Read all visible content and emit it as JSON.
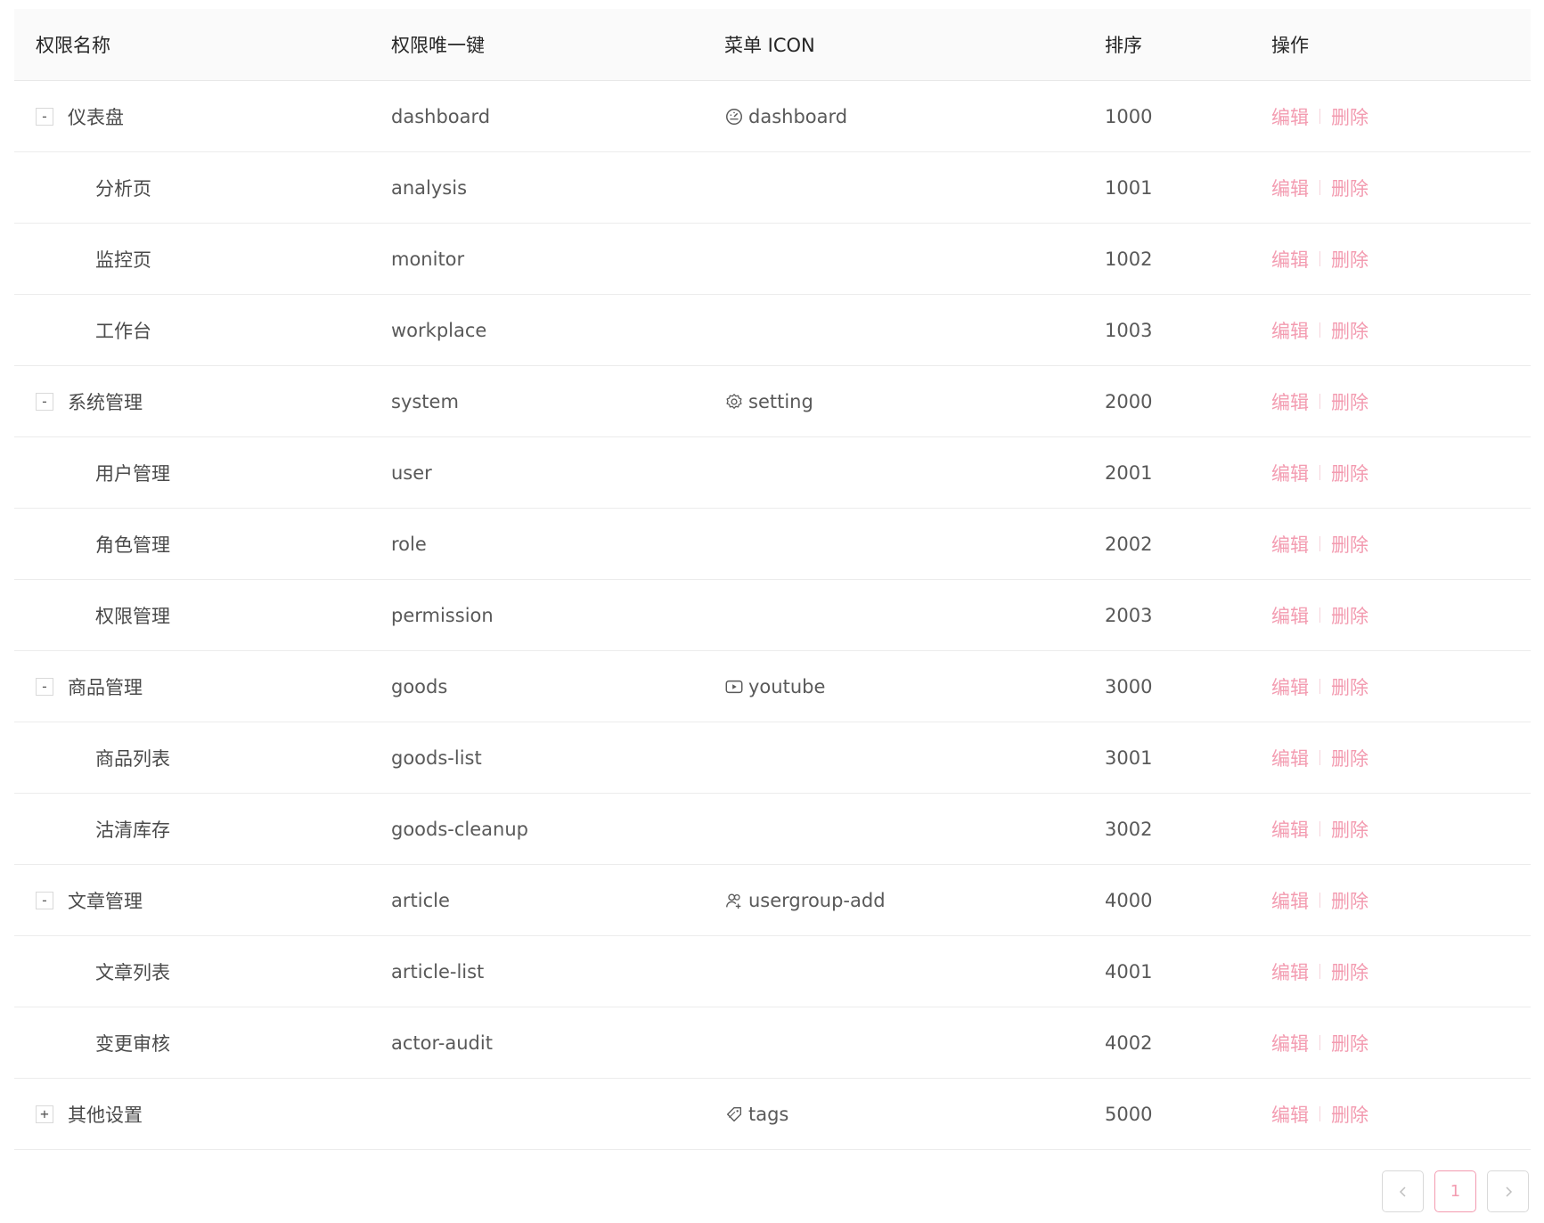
{
  "table": {
    "columns": {
      "name": "权限名称",
      "key": "权限唯一键",
      "icon": "菜单 ICON",
      "sort": "排序",
      "ops": "操作"
    },
    "rows": [
      {
        "name": "仪表盘",
        "key": "dashboard",
        "icon": "dashboard",
        "icon_name": "dashboard-icon",
        "sort": "1000",
        "level": 0,
        "toggle": "-"
      },
      {
        "name": "分析页",
        "key": "analysis",
        "icon": "",
        "sort": "1001",
        "level": 1
      },
      {
        "name": "监控页",
        "key": "monitor",
        "icon": "",
        "sort": "1002",
        "level": 1
      },
      {
        "name": "工作台",
        "key": "workplace",
        "icon": "",
        "sort": "1003",
        "level": 1
      },
      {
        "name": "系统管理",
        "key": "system",
        "icon": "setting",
        "icon_name": "setting-icon",
        "sort": "2000",
        "level": 0,
        "toggle": "-"
      },
      {
        "name": "用户管理",
        "key": "user",
        "icon": "",
        "sort": "2001",
        "level": 1
      },
      {
        "name": "角色管理",
        "key": "role",
        "icon": "",
        "sort": "2002",
        "level": 1
      },
      {
        "name": "权限管理",
        "key": "permission",
        "icon": "",
        "sort": "2003",
        "level": 1
      },
      {
        "name": "商品管理",
        "key": "goods",
        "icon": "youtube",
        "icon_name": "youtube-icon",
        "sort": "3000",
        "level": 0,
        "toggle": "-"
      },
      {
        "name": "商品列表",
        "key": "goods-list",
        "icon": "",
        "sort": "3001",
        "level": 1
      },
      {
        "name": "沽清库存",
        "key": "goods-cleanup",
        "icon": "",
        "sort": "3002",
        "level": 1
      },
      {
        "name": "文章管理",
        "key": "article",
        "icon": "usergroup-add",
        "icon_name": "usergroup-add-icon",
        "sort": "4000",
        "level": 0,
        "toggle": "-"
      },
      {
        "name": "文章列表",
        "key": "article-list",
        "icon": "",
        "sort": "4001",
        "level": 1
      },
      {
        "name": "变更审核",
        "key": "actor-audit",
        "icon": "",
        "sort": "4002",
        "level": 1
      },
      {
        "name": "其他设置",
        "key": "",
        "icon": "tags",
        "icon_name": "tags-icon",
        "sort": "5000",
        "level": 0,
        "toggle": "+"
      }
    ],
    "ops": {
      "edit": "编辑",
      "delete": "删除"
    }
  },
  "pagination": {
    "current_page": "1",
    "prev_icon": "chevron-left-icon",
    "next_icon": "chevron-right-icon"
  },
  "colors": {
    "accent": "#f39bb0",
    "header_bg": "#fafafa",
    "border": "#ececec"
  }
}
